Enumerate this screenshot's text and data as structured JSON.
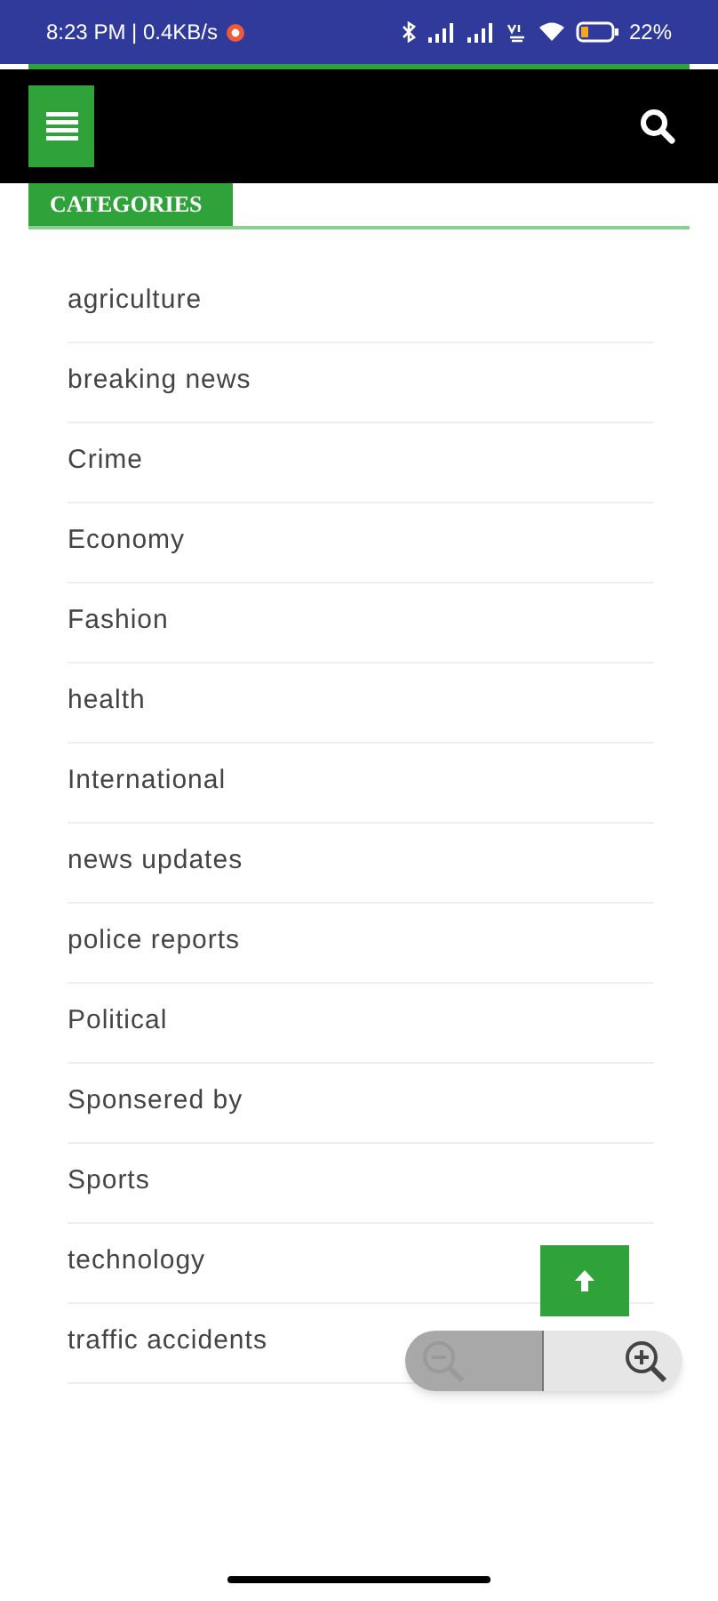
{
  "status_bar": {
    "time": "8:23 PM | 0.4KB/s",
    "battery": "22%"
  },
  "section": {
    "title": "CATEGORIES"
  },
  "categories": [
    "agriculture",
    "breaking news",
    "Crime",
    "Economy",
    "Fashion",
    "health",
    "International",
    "news updates",
    "police reports",
    "Political",
    "Sponsered by",
    "Sports",
    "technology",
    "traffic accidents"
  ],
  "zoom_controls": [
    {
      "kind": "zoom-out",
      "disabled": true
    },
    {
      "kind": "zoom-in",
      "disabled": false
    }
  ]
}
